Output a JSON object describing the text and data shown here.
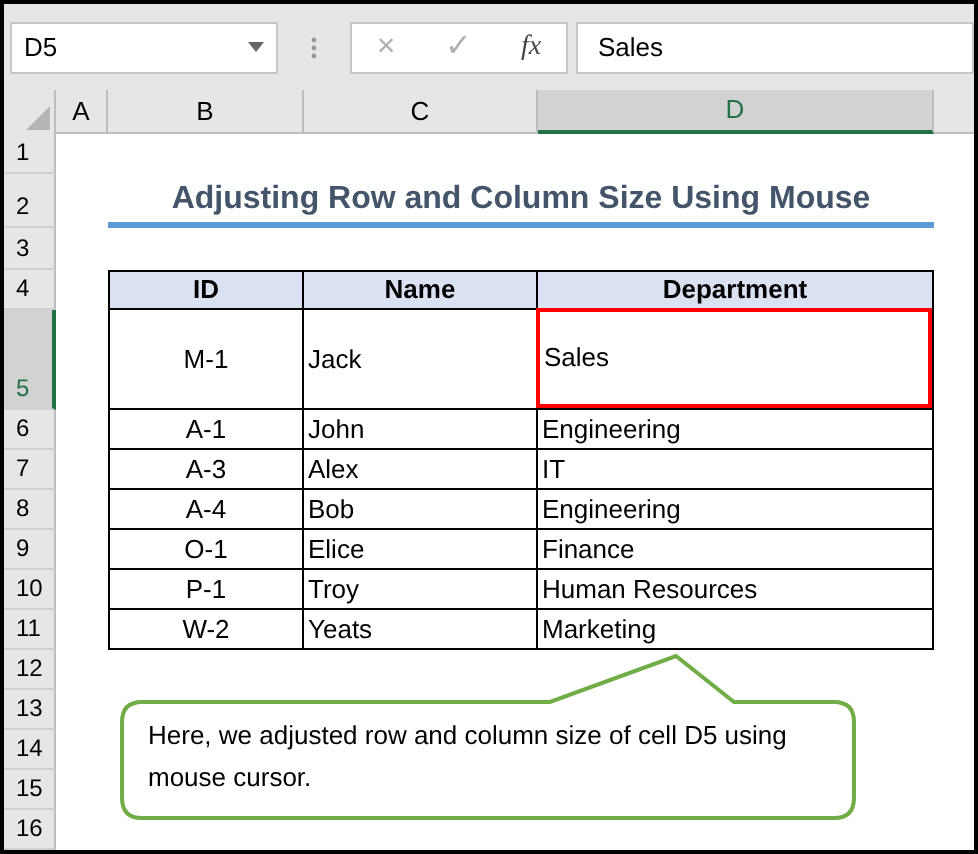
{
  "name_box": {
    "value": "D5"
  },
  "formula_bar": {
    "cancel": "×",
    "enter": "✓",
    "function_button": "fx",
    "value": "Sales"
  },
  "column_headers": [
    {
      "label": "A",
      "selected": false
    },
    {
      "label": "B",
      "selected": false
    },
    {
      "label": "C",
      "selected": false
    },
    {
      "label": "D",
      "selected": true
    }
  ],
  "row_headers": [
    {
      "label": "1",
      "selected": false
    },
    {
      "label": "2",
      "selected": false
    },
    {
      "label": "3",
      "selected": false
    },
    {
      "label": "4",
      "selected": false
    },
    {
      "label": "5",
      "selected": true
    },
    {
      "label": "6",
      "selected": false
    },
    {
      "label": "7",
      "selected": false
    },
    {
      "label": "8",
      "selected": false
    },
    {
      "label": "9",
      "selected": false
    },
    {
      "label": "10",
      "selected": false
    },
    {
      "label": "11",
      "selected": false
    },
    {
      "label": "12",
      "selected": false
    },
    {
      "label": "13",
      "selected": false
    },
    {
      "label": "14",
      "selected": false
    },
    {
      "label": "15",
      "selected": false
    },
    {
      "label": "16",
      "selected": false
    }
  ],
  "sheet": {
    "title": "Adjusting Row and Column Size Using Mouse",
    "table": {
      "columns": [
        "ID",
        "Name",
        "Department"
      ],
      "rows": [
        {
          "id": "M-1",
          "name": "Jack",
          "department": "Sales",
          "department_highlighted": true
        },
        {
          "id": "A-1",
          "name": "John",
          "department": "Engineering",
          "department_highlighted": false
        },
        {
          "id": "A-3",
          "name": "Alex",
          "department": "IT",
          "department_highlighted": false
        },
        {
          "id": "A-4",
          "name": "Bob",
          "department": "Engineering",
          "department_highlighted": false
        },
        {
          "id": "O-1",
          "name": "Elice",
          "department": "Finance",
          "department_highlighted": false
        },
        {
          "id": "P-1",
          "name": "Troy",
          "department": "Human Resources",
          "department_highlighted": false
        },
        {
          "id": "W-2",
          "name": "Yeats",
          "department": "Marketing",
          "department_highlighted": false
        }
      ]
    }
  },
  "callout": {
    "text": "Here, we adjusted row and column size of cell D5 using mouse cursor."
  }
}
